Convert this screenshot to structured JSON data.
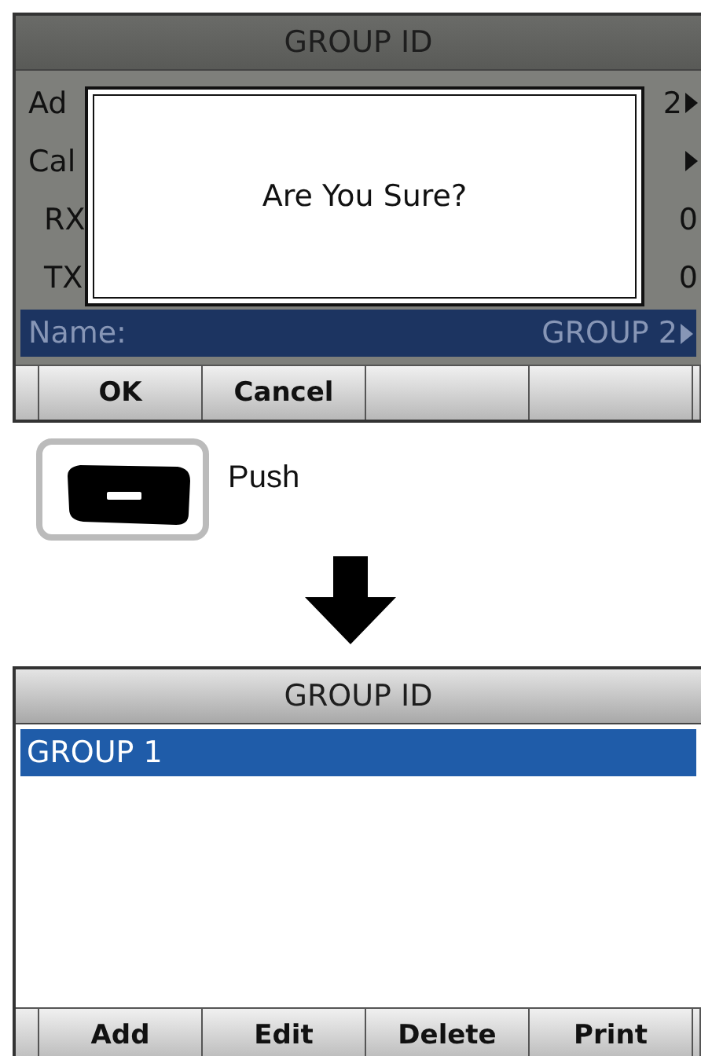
{
  "confirm_screen": {
    "title": "GROUP ID",
    "rows": [
      {
        "label": "Ad",
        "value": "2",
        "arrow": true,
        "selected": false
      },
      {
        "label": "Cal",
        "arrow": true,
        "selected": false,
        "children": [
          {
            "label": "RX",
            "value": "0",
            "arrow": false,
            "selected": false
          },
          {
            "label": "TX",
            "value": "0",
            "arrow": false,
            "selected": false
          }
        ]
      },
      {
        "label": "Name:",
        "value": "GROUP 2",
        "arrow": true,
        "selected": true
      }
    ],
    "dialog": {
      "message": "Are You Sure?"
    },
    "softkeys": [
      {
        "label": "OK"
      },
      {
        "label": "Cancel"
      }
    ]
  },
  "instruction": {
    "text": "Push"
  },
  "list_screen": {
    "title": "GROUP ID",
    "items": [
      {
        "label": "GROUP 1",
        "selected": true
      }
    ],
    "softkeys": [
      {
        "label": "Add"
      },
      {
        "label": "Edit"
      },
      {
        "label": "Delete"
      },
      {
        "label": "Print"
      }
    ]
  }
}
